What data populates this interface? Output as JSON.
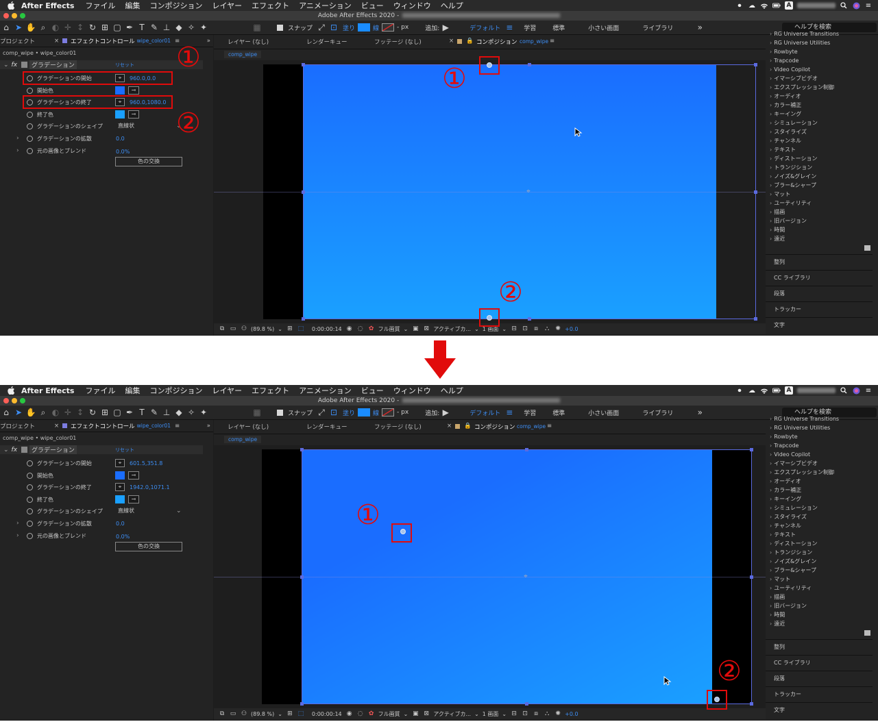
{
  "menubar": {
    "app_name": "After Effects",
    "items": [
      "ファイル",
      "編集",
      "コンポジション",
      "レイヤー",
      "エフェクト",
      "アニメーション",
      "ビュー",
      "ウィンドウ",
      "ヘルプ"
    ],
    "status_letter": "A"
  },
  "window": {
    "title": "Adobe After Effects 2020 - "
  },
  "toolbar": {
    "snap_label": "スナップ",
    "fill_label": "塗り",
    "stroke_label": "線",
    "px_label": "- px",
    "add_label": "追加:",
    "workspaces": [
      "デフォルト",
      "学習",
      "標準",
      "小さい画面",
      "ライブラリ"
    ],
    "active_workspace": "デフォルト",
    "help_placeholder": "ヘルプを検索",
    "fill_color": "#1a8cff",
    "stroke_color": "#d02a2a"
  },
  "left_panel": {
    "project_tab": "プロジェクト",
    "effect_controls_tab": "エフェクトコントロール",
    "effect_controls_layer": "wipe_color01",
    "path": "comp_wipe • wipe_color01",
    "fx_label": "fx",
    "effect_name": "グラデーション",
    "reset_label": "リセット",
    "swap_button": "色の交換",
    "properties": [
      {
        "name": "グラデーションの開始",
        "kind": "point"
      },
      {
        "name": "開始色",
        "kind": "color"
      },
      {
        "name": "グラデーションの終了",
        "kind": "point"
      },
      {
        "name": "終了色",
        "kind": "color"
      },
      {
        "name": "グラデーションのシェイプ",
        "kind": "select",
        "value": "直線状"
      },
      {
        "name": "グラデーションの拡散",
        "kind": "number",
        "value": "0.0"
      },
      {
        "name": "元の画像とブレンド",
        "kind": "number",
        "value": "0.0%"
      }
    ]
  },
  "viewer": {
    "tabs": [
      "レイヤー (なし)",
      "レンダーキュー",
      "フッテージ (なし)",
      "コンポジション"
    ],
    "comp_name": "comp_wipe",
    "zoom": "(89.8 %)",
    "timecode": "0:00:00:14",
    "quality": "フル画質",
    "camera": "アクティブカ...",
    "views": "1 画面",
    "exposure": "+0.0"
  },
  "right_panel": {
    "effects": [
      "RG Universe Transitions",
      "RG Universe Utilities",
      "Rowbyte",
      "Trapcode",
      "Video Copilot",
      "イマーシブビデオ",
      "エクスプレッション制御",
      "オーディオ",
      "カラー補正",
      "キーイング",
      "シミュレーション",
      "スタイライズ",
      "チャンネル",
      "テキスト",
      "ディストーション",
      "トランジション",
      "ノイズ&グレイン",
      "ブラー&シャープ",
      "マット",
      "ユーティリティ",
      "描画",
      "旧バージョン",
      "時間",
      "遠近"
    ],
    "sections": [
      "整列",
      "CC ライブラリ",
      "段落",
      "トラッカー",
      "文字"
    ]
  },
  "before": {
    "start_point": "960.0,0.0",
    "end_point": "960.0,1080.0",
    "start_color": "#1a6dff",
    "end_color": "#1aa0ff"
  },
  "after": {
    "start_point": "601.5,351.8",
    "end_point": "1942.0,1071.1",
    "start_color": "#1a6dff",
    "end_color": "#1aa0ff"
  },
  "annotations": {
    "marker_1": "①",
    "marker_2": "②",
    "arrow_color": "#e10b0b"
  }
}
